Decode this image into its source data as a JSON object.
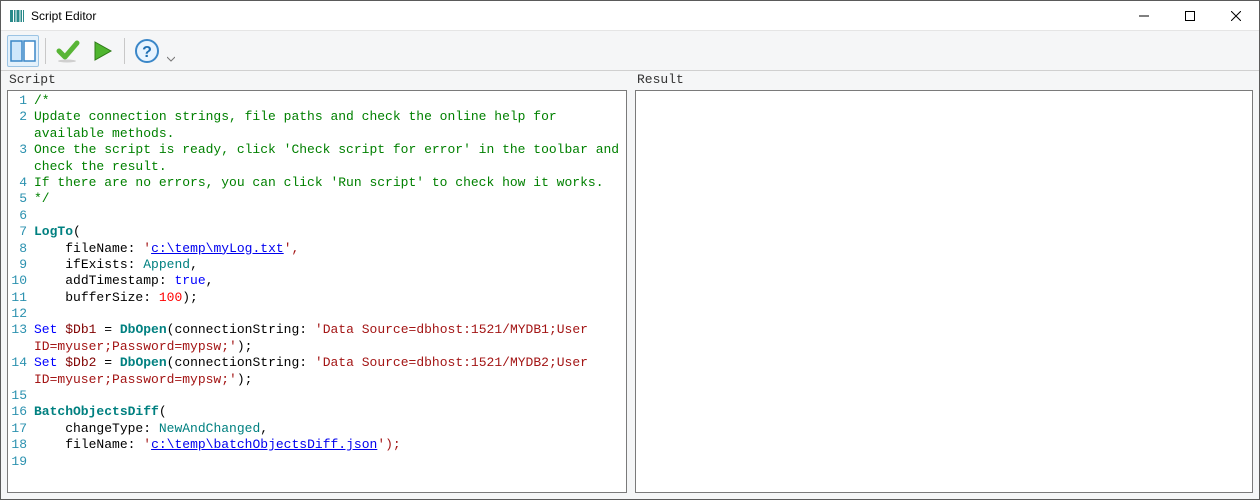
{
  "window": {
    "title": "Script Editor"
  },
  "toolbar": {
    "items": {
      "toggle_panels": "Toggle panels",
      "check_script": "Check script for error",
      "run_script": "Run script",
      "help": "Help"
    }
  },
  "panels": {
    "script_header": "Script",
    "result_header": "Result"
  },
  "code": {
    "lines": [
      {
        "n": 1,
        "type": "comment",
        "text": "/*"
      },
      {
        "n": 2,
        "type": "comment",
        "text": "Update connection strings, file paths and check the online help for"
      },
      {
        "n": null,
        "type": "comment",
        "text": "available methods."
      },
      {
        "n": 3,
        "type": "comment",
        "text": "Once the script is ready, click 'Check script for error' in the toolbar and"
      },
      {
        "n": null,
        "type": "comment",
        "text": "check the result."
      },
      {
        "n": 4,
        "type": "comment",
        "text": "If there are no errors, you can click 'Run script' to check how it works."
      },
      {
        "n": 5,
        "type": "comment",
        "text": "*/"
      },
      {
        "n": 6,
        "type": "blank",
        "text": ""
      },
      {
        "n": 7,
        "type": "call-open",
        "func": "LogTo",
        "tail": "("
      },
      {
        "n": 8,
        "type": "arg-path",
        "key": "fileName",
        "prefix": "'",
        "path": "c:\\temp\\myLog.txt",
        "suffix": "',"
      },
      {
        "n": 9,
        "type": "arg-enum",
        "key": "ifExists",
        "value": "Append",
        "tail": ","
      },
      {
        "n": 10,
        "type": "arg-bool",
        "key": "addTimestamp",
        "value": "true",
        "tail": ","
      },
      {
        "n": 11,
        "type": "arg-num",
        "key": "bufferSize",
        "value": "100",
        "tail": ");"
      },
      {
        "n": 12,
        "type": "blank",
        "text": ""
      },
      {
        "n": 13,
        "type": "set-open",
        "kw": "Set",
        "var": "$Db1",
        "eq": " = ",
        "func": "DbOpen",
        "open": "(",
        "argkey": "connectionString",
        "strStart": "'Data Source=dbhost:1521/MYDB1;User"
      },
      {
        "n": null,
        "type": "set-cont",
        "strEnd": "ID=myuser;Password=mypsw;'",
        "tail": ");"
      },
      {
        "n": 14,
        "type": "set-open",
        "kw": "Set",
        "var": "$Db2",
        "eq": " = ",
        "func": "DbOpen",
        "open": "(",
        "argkey": "connectionString",
        "strStart": "'Data Source=dbhost:1521/MYDB2;User"
      },
      {
        "n": null,
        "type": "set-cont",
        "strEnd": "ID=myuser;Password=mypsw;'",
        "tail": ");"
      },
      {
        "n": 15,
        "type": "blank",
        "text": ""
      },
      {
        "n": 16,
        "type": "call-open",
        "func": "BatchObjectsDiff",
        "tail": "("
      },
      {
        "n": 17,
        "type": "arg-enum",
        "key": "changeType",
        "value": "NewAndChanged",
        "tail": ","
      },
      {
        "n": 18,
        "type": "arg-path",
        "key": "fileName",
        "prefix": "'",
        "path": "c:\\temp\\batchObjectsDiff.json",
        "suffix": "');"
      },
      {
        "n": 19,
        "type": "blank",
        "text": ""
      }
    ]
  },
  "result": {
    "text": ""
  }
}
